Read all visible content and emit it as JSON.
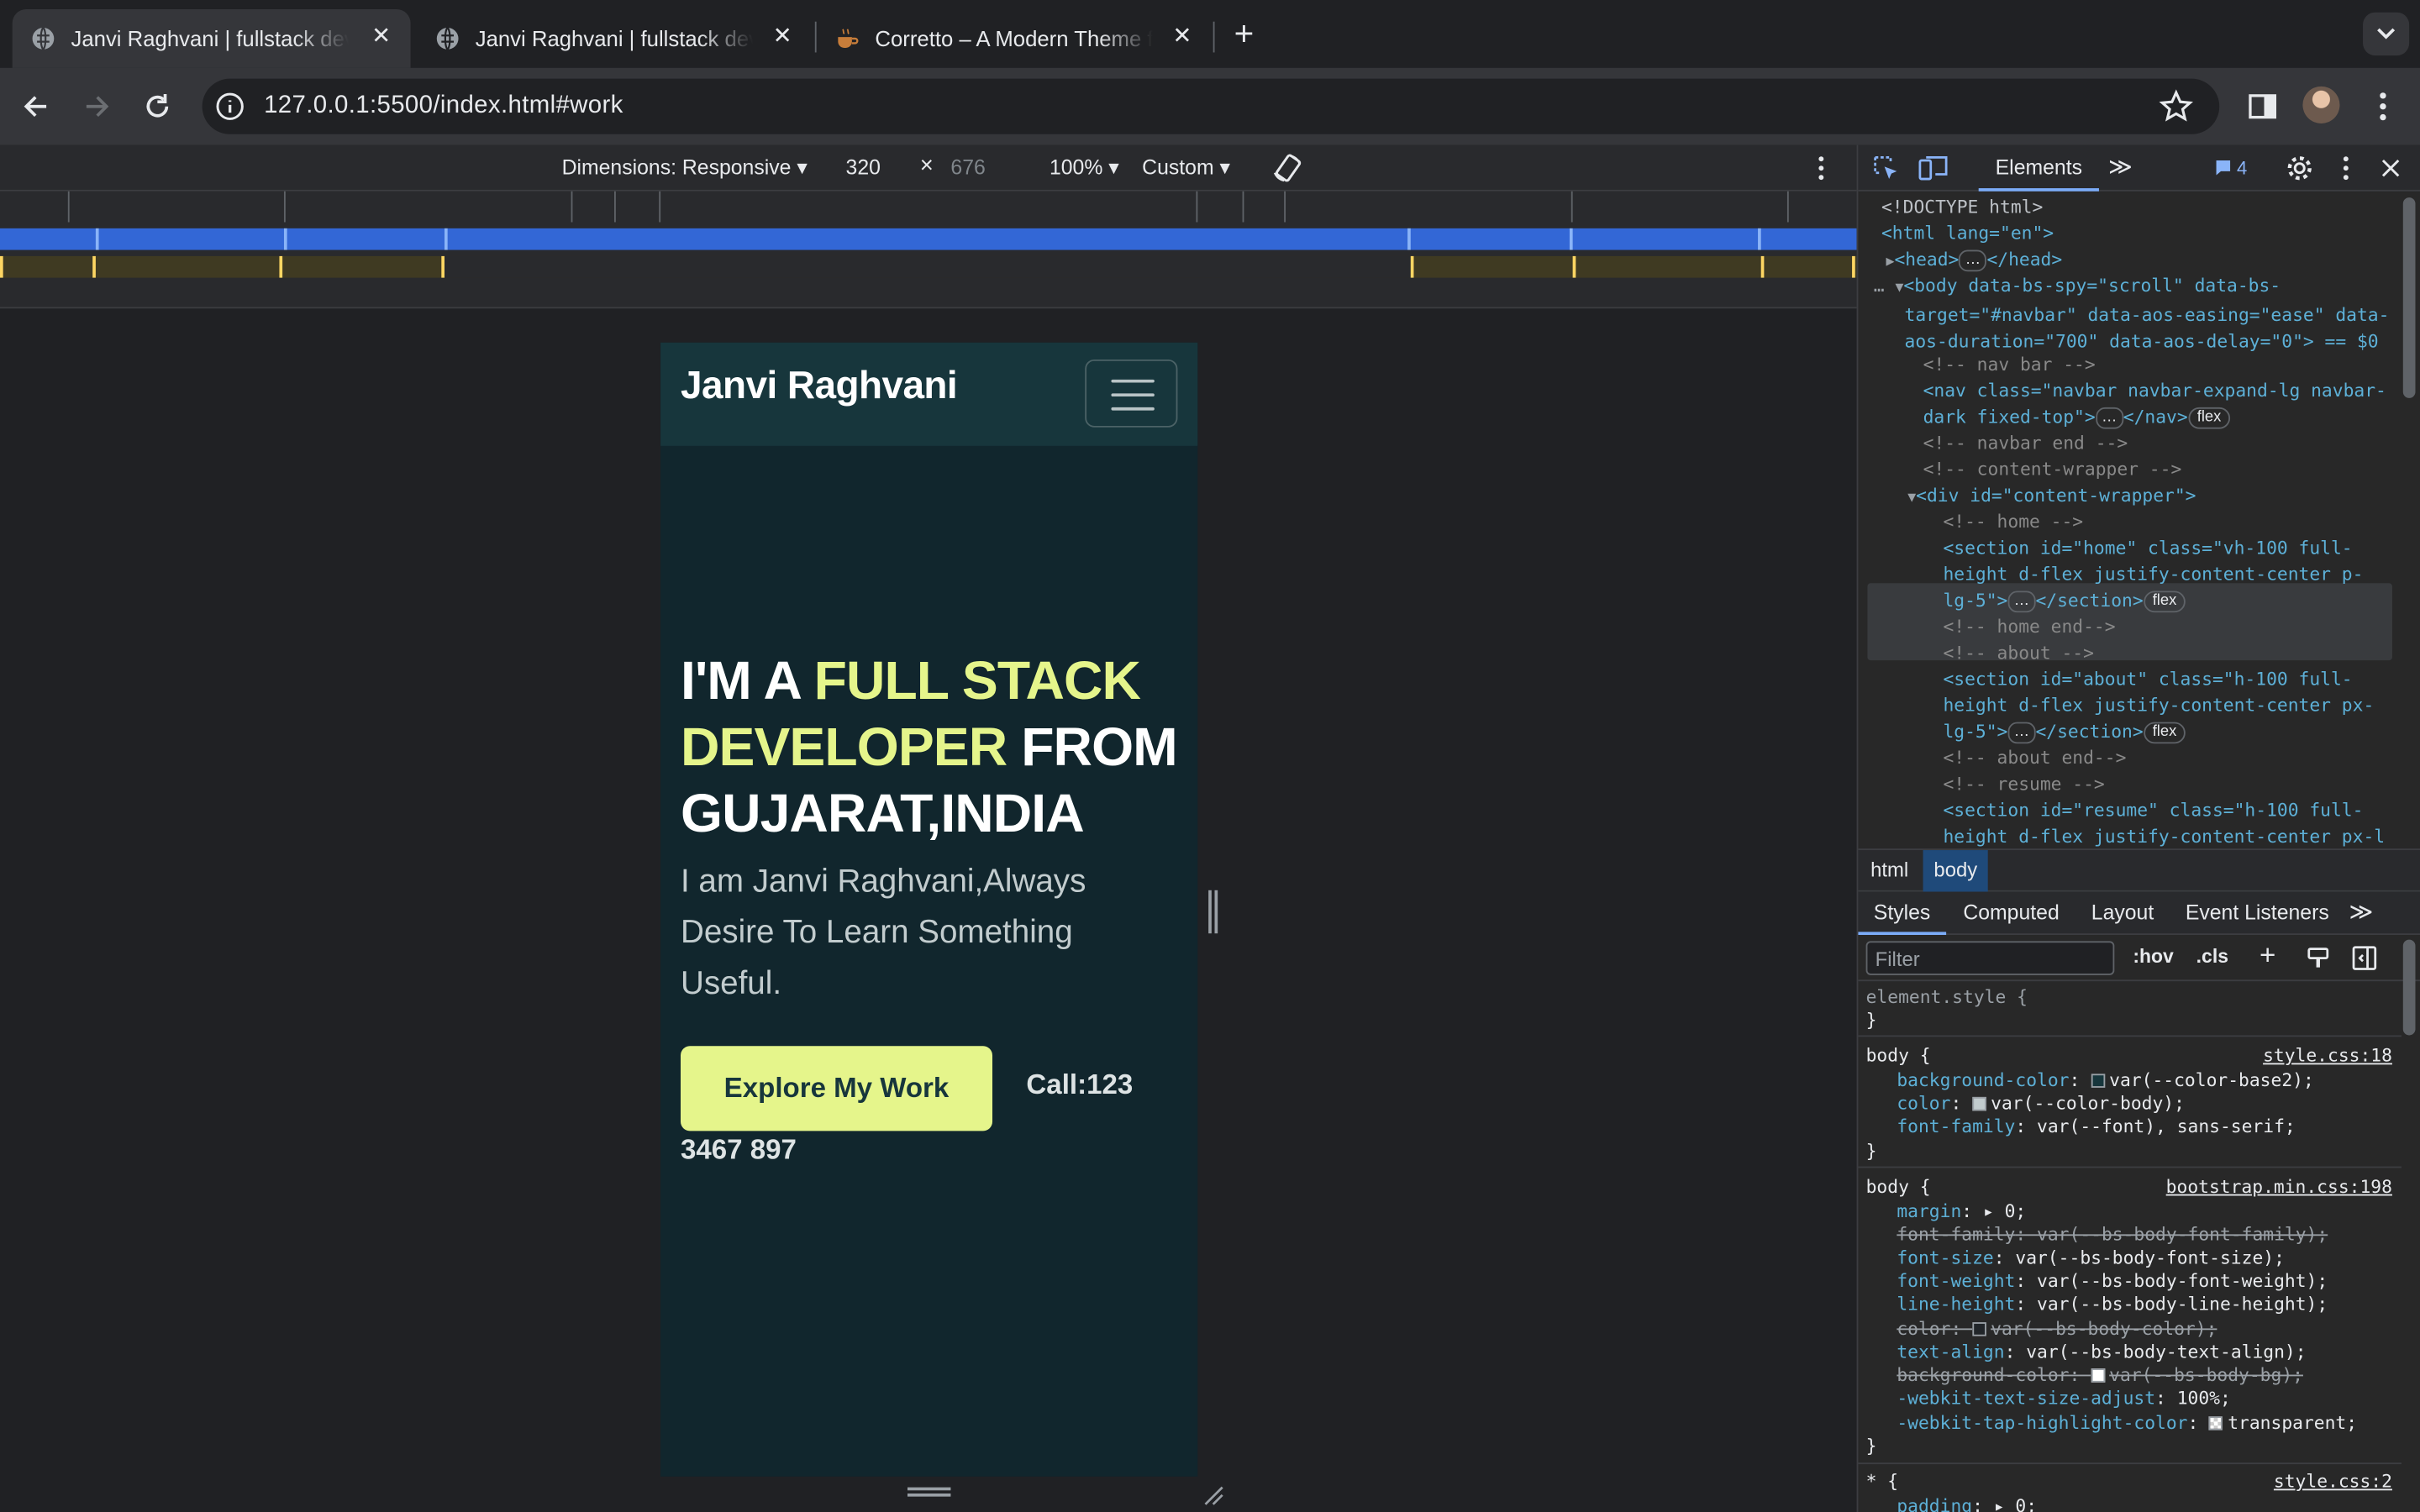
{
  "browser": {
    "tabs": [
      {
        "title": "Janvi Raghvani | fullstack developer",
        "icon": "globe-icon",
        "active": true
      },
      {
        "title": "Janvi Raghvani | fullstack developer",
        "icon": "globe-icon",
        "active": false
      },
      {
        "title": "Corretto – A Modern Theme for",
        "icon": "coffee-icon",
        "active": false
      }
    ],
    "new_tab_icon": "plus-icon",
    "url": "127.0.0.1:5500/index.html#work"
  },
  "device_toolbar": {
    "dimensions": "Dimensions: Responsive",
    "width": "320",
    "x": "×",
    "height": "676",
    "zoom": "100%",
    "throttle": "Custom"
  },
  "page": {
    "brand": "Janvi Raghvani",
    "hero": {
      "part1": "I'M A ",
      "highlight": "FULL STACK DEVELOPER",
      "part2": " FROM GUJARAT,INDIA"
    },
    "subtitle": "I am Janvi Raghvani,Always Desire To Learn Something Useful.",
    "cta": "Explore My Work",
    "call_line1": "Call:123",
    "call_line2": "3467 897",
    "colors": {
      "bg": "#11262d",
      "nav": "#17363c",
      "accent": "#e5f58b"
    }
  },
  "devtools": {
    "elements_tab": "Elements",
    "issues_count": "4",
    "dom": [
      "<!DOCTYPE html>",
      "<html lang=\"en\">",
      "<head>",
      "</head>",
      "<body data-bs-spy=\"scroll\" data-bs-target=\"#navbar\" data-aos-easing=\"ease\" data-aos-duration=\"700\" data-aos-delay=\"0\"> == $0",
      "<!-- nav bar -->",
      "<nav class=\"navbar navbar-expand-lg navbar-dark fixed-top\">",
      "</nav>",
      "flex",
      "<!-- navbar end -->",
      "<!-- content-wrapper -->",
      "<div id=\"content-wrapper\">",
      "<!-- home -->",
      "<section id=\"home\" class=\"vh-100 full-height d-flex justify-content-center p-lg-5\">",
      "</section>",
      "<!-- home  end-->",
      "<!-- about -->",
      "<section id=\"about\" class=\"h-100 full-height d-flex justify-content-center px-lg-5\">",
      "<!-- about end-->",
      "<!-- resume -->",
      "<section id=\"resume\" class=\"h-100 full-height d-flex justify-content-center px-l"
    ],
    "breadcrumbs": [
      "html",
      "body"
    ],
    "subtabs": [
      "Styles",
      "Computed",
      "Layout",
      "Event Listeners"
    ],
    "filter_placeholder": "Filter",
    "hov": ":hov",
    "cls": ".cls",
    "styles": {
      "element_style": "element.style {",
      "close": "}",
      "rule1": {
        "selector": "body {",
        "source": "style.css:18",
        "props": [
          {
            "name": "background-color",
            "value": "var(--color-base2);"
          },
          {
            "name": "color",
            "value": "var(--color-body);"
          },
          {
            "name": "font-family",
            "value": "var(--font), sans-serif;"
          }
        ]
      },
      "rule2": {
        "selector": "body {",
        "source": "bootstrap.min.css:198",
        "props": [
          {
            "name": "margin",
            "value": "▸ 0;"
          },
          {
            "name": "font-family",
            "value": "var(--bs-body-font-family);"
          },
          {
            "name": "font-size",
            "value": "var(--bs-body-font-size);"
          },
          {
            "name": "font-weight",
            "value": "var(--bs-body-font-weight);"
          },
          {
            "name": "line-height",
            "value": "var(--bs-body-line-height);"
          },
          {
            "name": "color",
            "value": "var(--bs-body-color);"
          },
          {
            "name": "text-align",
            "value": "var(--bs-body-text-align);"
          },
          {
            "name": "background-color",
            "value": "var(--bs-body-bg);"
          },
          {
            "name": "-webkit-text-size-adjust",
            "value": "100%;"
          },
          {
            "name": "-webkit-tap-highlight-color",
            "value": "transparent;"
          }
        ]
      },
      "rule3": {
        "selector": "* {",
        "source": "style.css:2",
        "props": [
          {
            "name": "padding",
            "value": "▸ 0;"
          }
        ]
      }
    }
  }
}
